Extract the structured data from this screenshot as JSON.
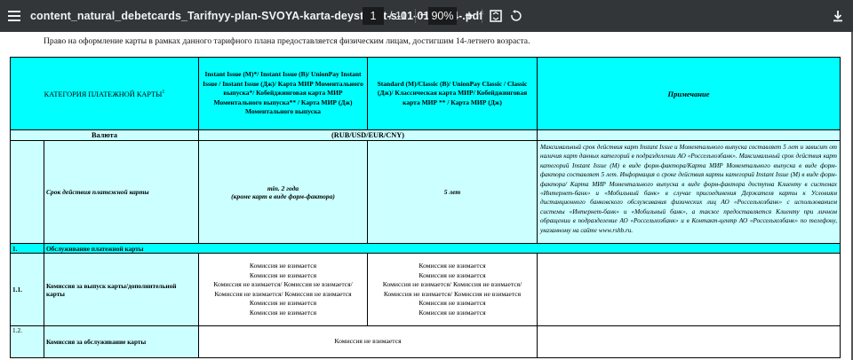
{
  "viewer": {
    "filename": "content_natural_debetcards_Tarifnyy-plan-SVOYA-karta-deystvuet-s-01-01-2024-.pdf",
    "page_current": "1",
    "page_total": "/ 11",
    "zoom": "90%",
    "icons": [
      "menu-icon",
      "minus-icon",
      "plus-icon",
      "fit-page-icon",
      "rotate-icon",
      "download-icon"
    ]
  },
  "doc": {
    "intro": "Право на оформление карты в рамках данного тарифного плана предоставляется физическим лицам, достигшим 14-летнего возраста.",
    "header": {
      "category": "КАТЕГОРИЯ ПЛАТЕЖНОЙ КАРТЫ",
      "category_sup": "1",
      "col_instant": "Instant Issue (М)*/ Instant Issue (В)/ UnionPay Instant Issue / Instant Issue (Дж)/ Карта МИР Моментального выпуска*/ Кобейджинговая карта МИР Моментального выпуска** / Карта МИР (Дж) Моментального выпуска",
      "col_standard": "Standard (М)/Classic (В)/ UnionPay Classic / Classic (Дж)/ Классическая карта МИР/ Кобейджинговая карта МИР ** / Карта МИР (Дж)",
      "col_note": "Примечание"
    },
    "currency": {
      "label": "Валюта",
      "value": "(RUB/USD/EUR/CNY)"
    },
    "validity": {
      "label": "Срок действия платежной карты",
      "instant_line1": "тіп. 2 года",
      "instant_line2": "(кроме карт в виде форм-фактора)",
      "standard": "5 лет",
      "note": "Максимальный срок действия карт Instant Issue и Моментального выпуска составляет 5 лет и зависит от наличия карт данных категорий в подразделении АО «Россельхозбанк». Максимальный срок действия карт категорий Instant Issue (М) в виде форм-фактора/Карта МИР Моментального выпуска в виде форм-фактора составляет 5 лет. Информация о сроке действия карты категорий Instant Issue (М) в виде форм-фактора/ Карта МИР Моментального выпуска в виде форм-фактора доступна Клиенту в системах «Интернет-банк» и «Мобильный банк» в случае присоединения Держателя карты к Условиям дистанционного банковского обслуживания физических лиц АО «Россельхозбанк» с использованием системы «Интернет-банк» и «Мобильный банк», а также предоставляется Клиенту при личном обращении в подразделение АО «Россельхозбанк» и в Контакт-центр АО «Россельхозбанк» по телефону, указанному на сайте www.rshb.ru."
    },
    "section1": {
      "number": "1.",
      "title": "Обслуживание платежной карты"
    },
    "row11": {
      "number": "1.1.",
      "label": "Комиссия за выпуск карты/дополнительной карты",
      "instant_lines": [
        "Комиссия не взимается",
        "Комиссия не взимается",
        "Комиссия не взимается/ Комиссия не взимается/",
        "Комиссия не взимается/ Комиссия не взимается",
        "Комиссия не взимается",
        "Комиссия не взимается"
      ],
      "standard_lines": [
        "Комиссия не взимается",
        "Комиссия не взимается",
        "Комиссия не взимается/ Комиссия не взимается/",
        "Комиссия не взимается/ Комиссия не взимается",
        "Комиссия не взимается",
        "Комиссия не взимается"
      ]
    },
    "row12": {
      "number": "1.2.",
      "label": "Комиссия за обслуживание карты",
      "value": "Комиссия не взимается"
    }
  }
}
